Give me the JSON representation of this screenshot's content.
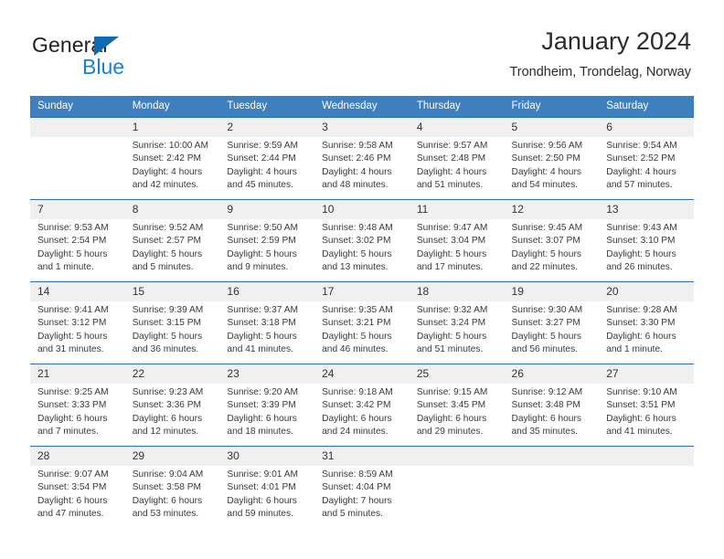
{
  "brand": {
    "name_part1": "General",
    "name_part2": "Blue",
    "triangle_color": "#1168b3",
    "blue_color": "#1b80cf"
  },
  "header": {
    "month_title": "January 2024",
    "location": "Trondheim, Trondelag, Norway"
  },
  "theme": {
    "header_bg": "#3d7fbf",
    "header_text": "#ffffff",
    "row_divider": "#2f6fae",
    "daynum_bg": "#f0f0f0",
    "body_text": "#3a3a3a"
  },
  "calendar": {
    "weekday_headers": [
      "Sunday",
      "Monday",
      "Tuesday",
      "Wednesday",
      "Thursday",
      "Friday",
      "Saturday"
    ],
    "weeks": [
      [
        {
          "day": "",
          "blank": true,
          "sunrise": "",
          "sunset": "",
          "daylight1": "",
          "daylight2": ""
        },
        {
          "day": "1",
          "sunrise": "Sunrise: 10:00 AM",
          "sunset": "Sunset: 2:42 PM",
          "daylight1": "Daylight: 4 hours",
          "daylight2": "and 42 minutes."
        },
        {
          "day": "2",
          "sunrise": "Sunrise: 9:59 AM",
          "sunset": "Sunset: 2:44 PM",
          "daylight1": "Daylight: 4 hours",
          "daylight2": "and 45 minutes."
        },
        {
          "day": "3",
          "sunrise": "Sunrise: 9:58 AM",
          "sunset": "Sunset: 2:46 PM",
          "daylight1": "Daylight: 4 hours",
          "daylight2": "and 48 minutes."
        },
        {
          "day": "4",
          "sunrise": "Sunrise: 9:57 AM",
          "sunset": "Sunset: 2:48 PM",
          "daylight1": "Daylight: 4 hours",
          "daylight2": "and 51 minutes."
        },
        {
          "day": "5",
          "sunrise": "Sunrise: 9:56 AM",
          "sunset": "Sunset: 2:50 PM",
          "daylight1": "Daylight: 4 hours",
          "daylight2": "and 54 minutes."
        },
        {
          "day": "6",
          "sunrise": "Sunrise: 9:54 AM",
          "sunset": "Sunset: 2:52 PM",
          "daylight1": "Daylight: 4 hours",
          "daylight2": "and 57 minutes."
        }
      ],
      [
        {
          "day": "7",
          "sunrise": "Sunrise: 9:53 AM",
          "sunset": "Sunset: 2:54 PM",
          "daylight1": "Daylight: 5 hours",
          "daylight2": "and 1 minute."
        },
        {
          "day": "8",
          "sunrise": "Sunrise: 9:52 AM",
          "sunset": "Sunset: 2:57 PM",
          "daylight1": "Daylight: 5 hours",
          "daylight2": "and 5 minutes."
        },
        {
          "day": "9",
          "sunrise": "Sunrise: 9:50 AM",
          "sunset": "Sunset: 2:59 PM",
          "daylight1": "Daylight: 5 hours",
          "daylight2": "and 9 minutes."
        },
        {
          "day": "10",
          "sunrise": "Sunrise: 9:48 AM",
          "sunset": "Sunset: 3:02 PM",
          "daylight1": "Daylight: 5 hours",
          "daylight2": "and 13 minutes."
        },
        {
          "day": "11",
          "sunrise": "Sunrise: 9:47 AM",
          "sunset": "Sunset: 3:04 PM",
          "daylight1": "Daylight: 5 hours",
          "daylight2": "and 17 minutes."
        },
        {
          "day": "12",
          "sunrise": "Sunrise: 9:45 AM",
          "sunset": "Sunset: 3:07 PM",
          "daylight1": "Daylight: 5 hours",
          "daylight2": "and 22 minutes."
        },
        {
          "day": "13",
          "sunrise": "Sunrise: 9:43 AM",
          "sunset": "Sunset: 3:10 PM",
          "daylight1": "Daylight: 5 hours",
          "daylight2": "and 26 minutes."
        }
      ],
      [
        {
          "day": "14",
          "sunrise": "Sunrise: 9:41 AM",
          "sunset": "Sunset: 3:12 PM",
          "daylight1": "Daylight: 5 hours",
          "daylight2": "and 31 minutes."
        },
        {
          "day": "15",
          "sunrise": "Sunrise: 9:39 AM",
          "sunset": "Sunset: 3:15 PM",
          "daylight1": "Daylight: 5 hours",
          "daylight2": "and 36 minutes."
        },
        {
          "day": "16",
          "sunrise": "Sunrise: 9:37 AM",
          "sunset": "Sunset: 3:18 PM",
          "daylight1": "Daylight: 5 hours",
          "daylight2": "and 41 minutes."
        },
        {
          "day": "17",
          "sunrise": "Sunrise: 9:35 AM",
          "sunset": "Sunset: 3:21 PM",
          "daylight1": "Daylight: 5 hours",
          "daylight2": "and 46 minutes."
        },
        {
          "day": "18",
          "sunrise": "Sunrise: 9:32 AM",
          "sunset": "Sunset: 3:24 PM",
          "daylight1": "Daylight: 5 hours",
          "daylight2": "and 51 minutes."
        },
        {
          "day": "19",
          "sunrise": "Sunrise: 9:30 AM",
          "sunset": "Sunset: 3:27 PM",
          "daylight1": "Daylight: 5 hours",
          "daylight2": "and 56 minutes."
        },
        {
          "day": "20",
          "sunrise": "Sunrise: 9:28 AM",
          "sunset": "Sunset: 3:30 PM",
          "daylight1": "Daylight: 6 hours",
          "daylight2": "and 1 minute."
        }
      ],
      [
        {
          "day": "21",
          "sunrise": "Sunrise: 9:25 AM",
          "sunset": "Sunset: 3:33 PM",
          "daylight1": "Daylight: 6 hours",
          "daylight2": "and 7 minutes."
        },
        {
          "day": "22",
          "sunrise": "Sunrise: 9:23 AM",
          "sunset": "Sunset: 3:36 PM",
          "daylight1": "Daylight: 6 hours",
          "daylight2": "and 12 minutes."
        },
        {
          "day": "23",
          "sunrise": "Sunrise: 9:20 AM",
          "sunset": "Sunset: 3:39 PM",
          "daylight1": "Daylight: 6 hours",
          "daylight2": "and 18 minutes."
        },
        {
          "day": "24",
          "sunrise": "Sunrise: 9:18 AM",
          "sunset": "Sunset: 3:42 PM",
          "daylight1": "Daylight: 6 hours",
          "daylight2": "and 24 minutes."
        },
        {
          "day": "25",
          "sunrise": "Sunrise: 9:15 AM",
          "sunset": "Sunset: 3:45 PM",
          "daylight1": "Daylight: 6 hours",
          "daylight2": "and 29 minutes."
        },
        {
          "day": "26",
          "sunrise": "Sunrise: 9:12 AM",
          "sunset": "Sunset: 3:48 PM",
          "daylight1": "Daylight: 6 hours",
          "daylight2": "and 35 minutes."
        },
        {
          "day": "27",
          "sunrise": "Sunrise: 9:10 AM",
          "sunset": "Sunset: 3:51 PM",
          "daylight1": "Daylight: 6 hours",
          "daylight2": "and 41 minutes."
        }
      ],
      [
        {
          "day": "28",
          "sunrise": "Sunrise: 9:07 AM",
          "sunset": "Sunset: 3:54 PM",
          "daylight1": "Daylight: 6 hours",
          "daylight2": "and 47 minutes."
        },
        {
          "day": "29",
          "sunrise": "Sunrise: 9:04 AM",
          "sunset": "Sunset: 3:58 PM",
          "daylight1": "Daylight: 6 hours",
          "daylight2": "and 53 minutes."
        },
        {
          "day": "30",
          "sunrise": "Sunrise: 9:01 AM",
          "sunset": "Sunset: 4:01 PM",
          "daylight1": "Daylight: 6 hours",
          "daylight2": "and 59 minutes."
        },
        {
          "day": "31",
          "sunrise": "Sunrise: 8:59 AM",
          "sunset": "Sunset: 4:04 PM",
          "daylight1": "Daylight: 7 hours",
          "daylight2": "and 5 minutes."
        },
        {
          "day": "",
          "blank": true,
          "sunrise": "",
          "sunset": "",
          "daylight1": "",
          "daylight2": ""
        },
        {
          "day": "",
          "blank": true,
          "sunrise": "",
          "sunset": "",
          "daylight1": "",
          "daylight2": ""
        },
        {
          "day": "",
          "blank": true,
          "sunrise": "",
          "sunset": "",
          "daylight1": "",
          "daylight2": ""
        }
      ]
    ]
  }
}
